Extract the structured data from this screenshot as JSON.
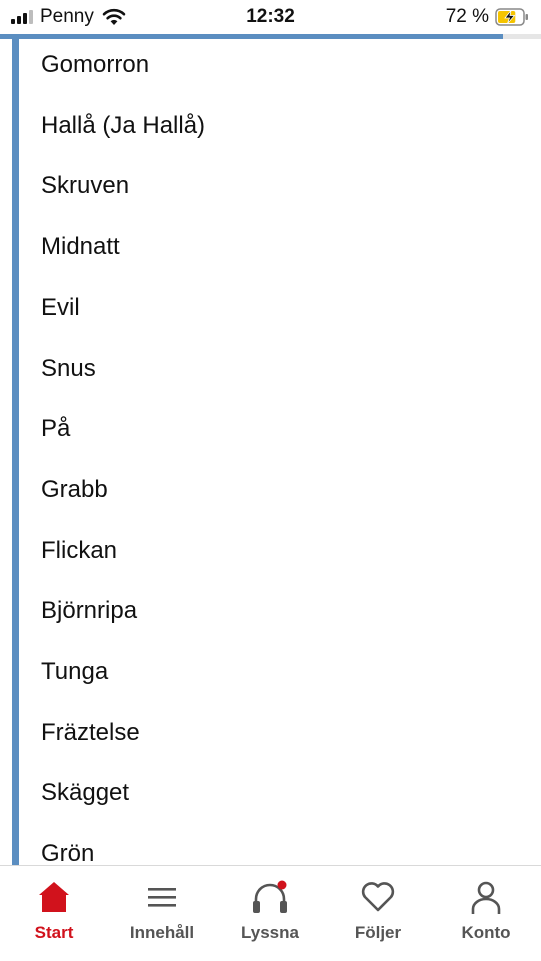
{
  "status_bar": {
    "carrier": "Penny",
    "time": "12:32",
    "battery_percent": "72 %",
    "signal_bars_active": 3,
    "signal_bars_total": 4,
    "battery_level": 0.72,
    "charging": true
  },
  "reading_progress": 0.93,
  "words": [
    "Gomorron",
    "Hallå (Ja Hallå)",
    "Skruven",
    "Midnatt",
    "Evil",
    "Snus",
    "På",
    "Grabb",
    "Flickan",
    "Björnripa",
    "Tunga",
    "Fräztelse",
    "Skägget",
    "Grön"
  ],
  "bottom_nav": {
    "items": [
      {
        "label": "Start",
        "icon": "home-icon",
        "active": true
      },
      {
        "label": "Innehåll",
        "icon": "menu-icon",
        "active": false
      },
      {
        "label": "Lyssna",
        "icon": "headphones-icon",
        "active": false,
        "badge": true
      },
      {
        "label": "Följer",
        "icon": "heart-icon",
        "active": false
      },
      {
        "label": "Konto",
        "icon": "person-icon",
        "active": false
      }
    ]
  },
  "colors": {
    "accent_blue": "#5b8ec1",
    "brand_red": "#d1121c",
    "inactive_gray": "#555555",
    "battery_yellow": "#f5c400"
  }
}
